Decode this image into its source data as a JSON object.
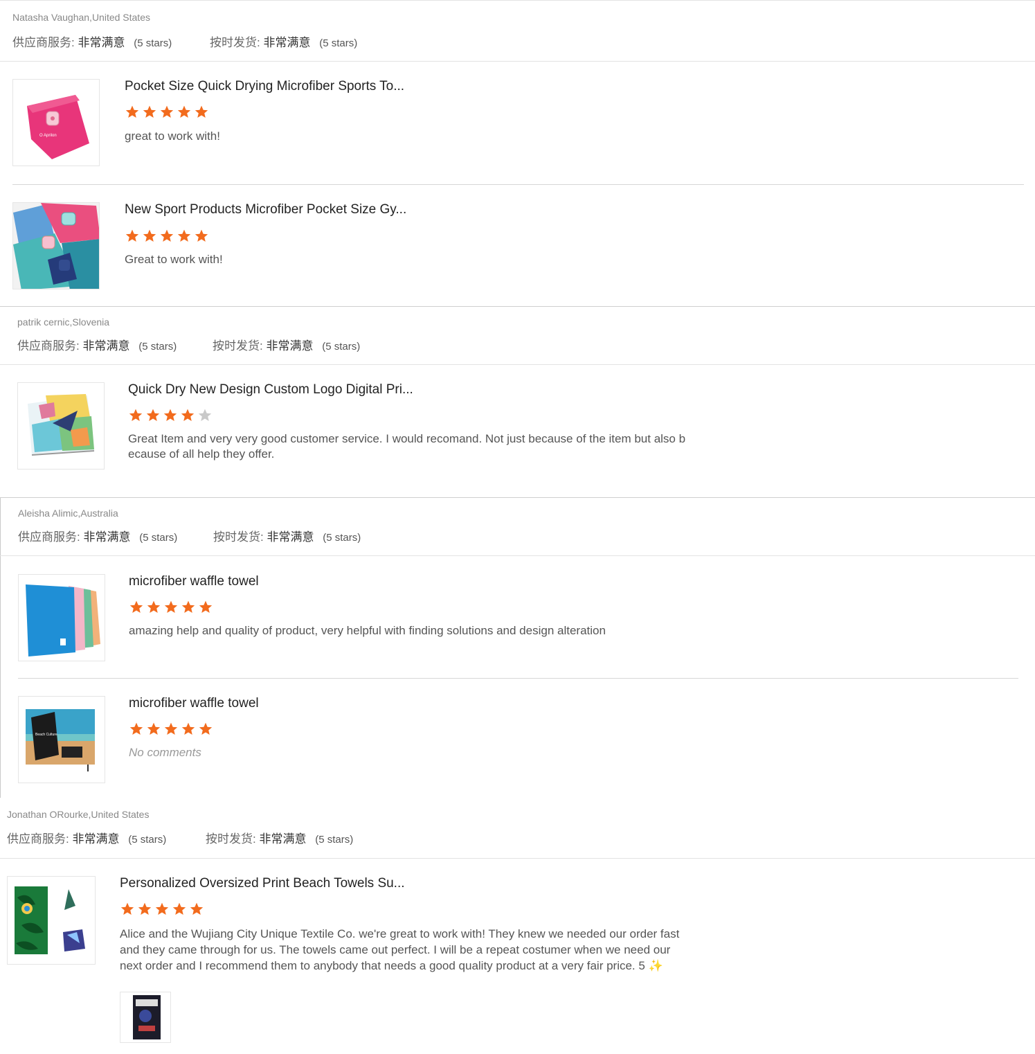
{
  "labels": {
    "supplier_service": "供应商服务:",
    "on_time": "按时发货:",
    "very_satisfied": "非常满意",
    "five_stars": "(5 stars)"
  },
  "colors": {
    "star_on": "#f26b1d",
    "star_off": "#c9c9c9"
  },
  "reviews": [
    {
      "author": "Natasha Vaughan,United States",
      "items": [
        {
          "title": "Pocket Size Quick Drying Microfiber Sports To...",
          "rating": 5,
          "comment": "great to work with!",
          "image": "pink-towel-image"
        },
        {
          "title": "New Sport Products Microfiber Pocket Size Gy...",
          "rating": 5,
          "comment": "Great to work with!",
          "image": "colorful-towels-image"
        }
      ]
    },
    {
      "author": "patrik cernic,Slovenia",
      "items": [
        {
          "title": "Quick Dry New Design Custom Logo Digital Pri...",
          "rating": 4,
          "comment": "Great Item and very very good customer service. I would recomand. Not just because of the item but also b ecause of all help they offer.",
          "image": "printed-towel-image"
        }
      ]
    },
    {
      "author": "Aleisha Alimic,Australia",
      "items": [
        {
          "title": "microfiber waffle towel",
          "rating": 5,
          "comment": "amazing help and quality of product, very helpful with finding solutions and design alteration",
          "image": "waffle-towels-image"
        },
        {
          "title": "microfiber waffle towel",
          "rating": 5,
          "comment": "No comments",
          "image": "beach-towel-bag-image"
        }
      ]
    },
    {
      "author": "Jonathan ORourke,United States",
      "items": [
        {
          "title": "Personalized Oversized Print Beach Towels Su...",
          "rating": 5,
          "comment": "Alice and the Wujiang City Unique Textile Co. we're great to work with!  They knew we needed our order fast and they came through for us.  The towels came out perfect.  I will be a repeat costumer when we need our next order and I recommend them to anybody that needs a good quality product at a very fair price.  5 ✨",
          "image": "palm-print-towels-image"
        }
      ]
    }
  ]
}
